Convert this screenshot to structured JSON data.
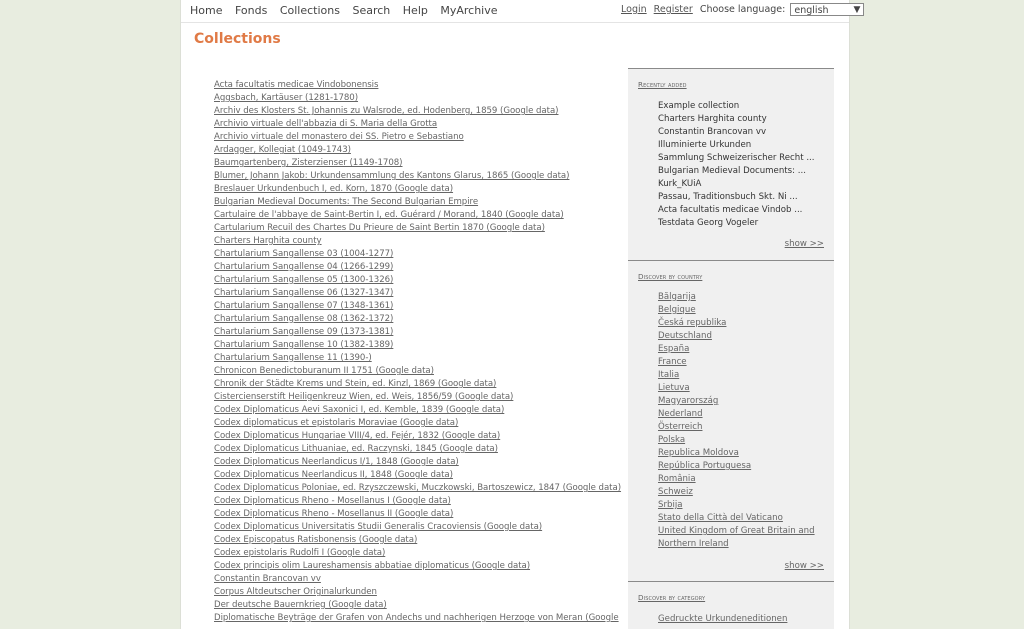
{
  "nav": {
    "items": [
      "Home",
      "Fonds",
      "Collections",
      "Search",
      "Help",
      "MyArchive"
    ],
    "login": "Login",
    "register": "Register",
    "choose_language": "Choose language:",
    "language_value": "english"
  },
  "page_title": "Collections",
  "collections": [
    "Acta facultatis medicae Vindobonensis",
    "Aggsbach, Kartäuser (1281-1780)",
    "Archiv des Klosters St. Johannis zu Walsrode, ed. Hodenberg, 1859 (Google data)",
    "Archivio virtuale dell'abbazia di S. Maria della Grotta",
    "Archivio virtuale del monastero dei SS. Pietro e Sebastiano",
    "Ardagger, Kollegiat (1049-1743)",
    "Baumgartenberg, Zisterzienser (1149-1708)",
    "Blumer, Johann Jakob: Urkundensammlung des Kantons Glarus, 1865 (Google data)",
    "Breslauer Urkundenbuch I, ed. Korn, 1870 (Google data)",
    "Bulgarian Medieval Documents: The Second Bulgarian Empire",
    "Cartulaire de l'abbaye de Saint-Bertin I, ed. Guérard / Morand, 1840 (Google data)",
    "Cartularium Recuil des Chartes Du Prieure de Saint Bertin 1870 (Google data)",
    "Charters Harghita county",
    "Chartularium Sangallense 03 (1004-1277)",
    "Chartularium Sangallense 04 (1266-1299)",
    "Chartularium Sangallense 05 (1300-1326)",
    "Chartularium Sangallense 06 (1327-1347)",
    "Chartularium Sangallense 07 (1348-1361)",
    "Chartularium Sangallense 08 (1362-1372)",
    "Chartularium Sangallense 09 (1373-1381)",
    "Chartularium Sangallense 10 (1382-1389)",
    "Chartularium Sangallense 11 (1390-)",
    "Chronicon Benedictoburanum II 1751 (Google data)",
    "Chronik der Städte Krems und Stein, ed. Kinzl, 1869 (Google data)",
    "Cistercienserstift Heiligenkreuz Wien, ed. Weis, 1856/59 (Google data)",
    "Codex Diplomaticus Aevi Saxonici I, ed. Kemble, 1839 (Google data)",
    "Codex diplomaticus et epistolaris Moraviae (Google data)",
    "Codex Diplomaticus Hungariae VIII/4, ed. Fejér, 1832 (Google data)",
    "Codex Diplomaticus Lithuaniae, ed. Raczynski, 1845 (Google data)",
    "Codex Diplomaticus Neerlandicus I/1, 1848 (Google data)",
    "Codex Diplomaticus Neerlandicus II, 1848 (Google data)",
    "Codex Diplomaticus Poloniae, ed. Rzyszczewski, Muczkowski, Bartoszewicz, 1847 (Google data)",
    "Codex Diplomaticus Rheno - Mosellanus I (Google data)",
    "Codex Diplomaticus Rheno - Mosellanus II (Google data)",
    "Codex Diplomaticus Universitatis Studii Generalis Cracoviensis (Google data)",
    "Codex Episcopatus Ratisbonensis (Google data)",
    "Codex epistolaris Rudolfi I (Google data)",
    "Codex principis olim Laureshamensis abbatiae diplomaticus (Google data)",
    "Constantin Brancovan vv",
    "Corpus Altdeutscher Originalurkunden",
    "Der deutsche Bauernkrieg (Google data)",
    "Diplomatische Beyträge der Grafen von Andechs und nachherigen Herzoge von Meran (Google"
  ],
  "sidebar": {
    "recently_added": {
      "title": "Recently added",
      "items": [
        "Example collection",
        "Charters Harghita county",
        "Constantin Brancovan vv",
        "Illuminierte Urkunden",
        "Sammlung Schweizerischer Recht ...",
        "Bulgarian Medieval Documents: ...",
        "Kurk_KUiA",
        "Passau, Traditionsbuch Skt. Ni ...",
        "Acta facultatis medicae Vindob ...",
        "Testdata Georg Vogeler"
      ],
      "show": "show >>"
    },
    "by_country": {
      "title": "Discover by country",
      "items": [
        "Bălgarija",
        "Belgique",
        "Česká republika",
        "Deutschland",
        "España",
        "France",
        "Italia",
        "Lietuva",
        "Magyarország",
        "Nederland",
        "Österreich",
        "Polska",
        "Republica Moldova",
        "República Portuguesa",
        "România",
        "Schweiz",
        "Srbija",
        "Stato della Città del Vaticano",
        "United Kingdom of Great Britain and Northern Ireland"
      ],
      "show": "show >>"
    },
    "by_category": {
      "title": "Discover by category",
      "items": [
        "Gedruckte Urkundeneditionen"
      ]
    }
  }
}
